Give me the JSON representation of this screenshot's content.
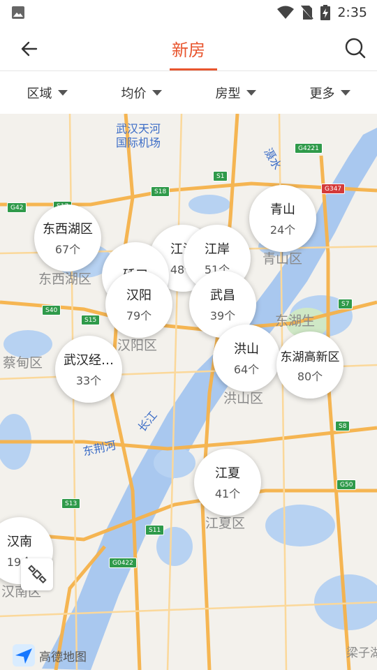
{
  "status": {
    "time": "2:35"
  },
  "nav": {
    "title": "新房"
  },
  "filters": [
    {
      "label": "区域"
    },
    {
      "label": "均价"
    },
    {
      "label": "房型"
    },
    {
      "label": "更多"
    }
  ],
  "map": {
    "labels": [
      {
        "text": "武汉天河\n国际机场",
        "kind": "blue"
      },
      {
        "text": "东西湖区",
        "kind": "gray"
      },
      {
        "text": "青山区",
        "kind": "gray"
      },
      {
        "text": "汉阳区",
        "kind": "gray"
      },
      {
        "text": "蔡甸区",
        "kind": "gray"
      },
      {
        "text": "洪山区",
        "kind": "gray"
      },
      {
        "text": "江夏区",
        "kind": "gray"
      },
      {
        "text": "汉南区",
        "kind": "gray"
      },
      {
        "text": "东湖生",
        "kind": "gray"
      },
      {
        "text": "梁子湖",
        "kind": "gray"
      },
      {
        "text": "长江",
        "kind": "blue"
      },
      {
        "text": "东荆河",
        "kind": "blue"
      },
      {
        "text": "滠水",
        "kind": "blue"
      }
    ],
    "bubbles": [
      {
        "name": "东西湖区",
        "count": "67个"
      },
      {
        "name": "青山",
        "count": "24个"
      },
      {
        "name": "江汉",
        "count": "48个"
      },
      {
        "name": "江岸",
        "count": "51个"
      },
      {
        "name": "硚口",
        "count": ""
      },
      {
        "name": "汉阳",
        "count": "79个"
      },
      {
        "name": "武昌",
        "count": "39个"
      },
      {
        "name": "武汉经…",
        "count": "33个"
      },
      {
        "name": "洪山",
        "count": "64个"
      },
      {
        "name": "东湖高新区",
        "count": "80个"
      },
      {
        "name": "江夏",
        "count": "41个"
      },
      {
        "name": "汉南",
        "count": "19个"
      }
    ],
    "road_badges": [
      "G42",
      "S17",
      "S18",
      "S1",
      "G4221",
      "G347",
      "S7",
      "S40",
      "S15",
      "S8",
      "G50",
      "S13",
      "S11",
      "G0422"
    ],
    "logo_text": "高德地图"
  }
}
